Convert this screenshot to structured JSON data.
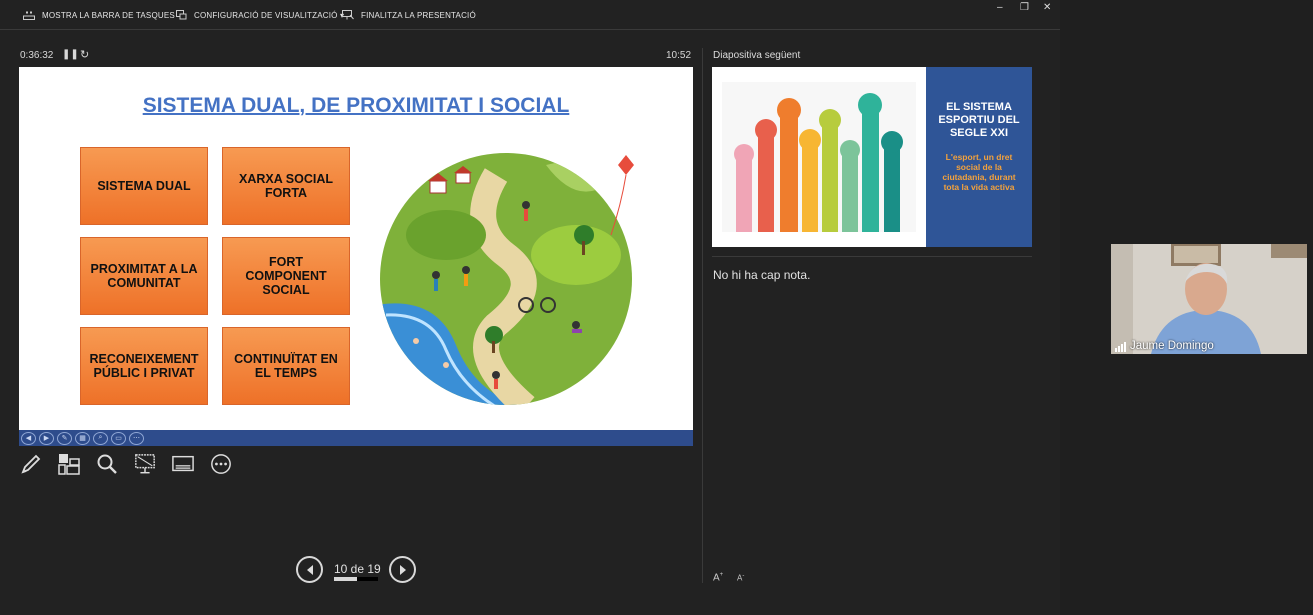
{
  "toolbar": {
    "taskbar": "MOSTRA LA BARRA DE TASQUES",
    "display": "CONFIGURACIÓ DE VISUALITZACIÓ ▾",
    "end": "FINALITZA LA PRESENTACIÓ"
  },
  "window": {
    "minimize": "–",
    "restore": "❐",
    "close": "✕"
  },
  "status": {
    "elapsed": "0:36:32",
    "clock": "10:52"
  },
  "slide": {
    "title": "SISTEMA DUAL, DE PROXIMITAT I SOCIAL",
    "boxes": [
      "SISTEMA DUAL",
      "XARXA SOCIAL FORTA",
      "PROXIMITAT A LA COMUNITAT",
      "FORT COMPONENT SOCIAL",
      "RECONEIXEMENT PÚBLIC I PRIVAT",
      "CONTINUÏTAT EN EL TEMPS"
    ]
  },
  "navigation": {
    "counter": "10 de 19",
    "current": 10,
    "total": 19,
    "progress": 0.53
  },
  "next": {
    "label": "Diapositiva següent",
    "title": "EL SISTEMA ESPORTIU DEL SEGLE XXI",
    "subtitle": "L'esport, un dret social de la ciutadania, durant tota la vida activa"
  },
  "notes": {
    "text": "No hi ha cap nota."
  },
  "fontsize": {
    "up": "A",
    "down": "A"
  },
  "camera": {
    "name": "Jaume Domingo"
  },
  "tools": [
    "pen-icon",
    "slides-grid-icon",
    "zoom-icon",
    "black-screen-icon",
    "subtitles-icon",
    "more-icon"
  ],
  "colors": {
    "accent_blue": "#4472c4",
    "box_orange": "#ee7128",
    "footer_blue": "#2e4c8c",
    "next_blue": "#2f5597",
    "next_orange": "#f4a23c"
  }
}
